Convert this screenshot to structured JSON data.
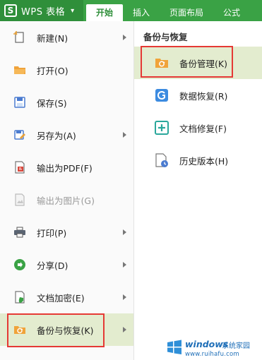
{
  "app": {
    "logo_letter": "S",
    "title": "WPS 表格"
  },
  "tabs": [
    {
      "label": "开始",
      "active": true
    },
    {
      "label": "插入",
      "active": false
    },
    {
      "label": "页面布局",
      "active": false
    },
    {
      "label": "公式",
      "active": false
    }
  ],
  "menu": {
    "items": [
      {
        "label": "新建(N)",
        "icon": "new-file-icon",
        "submenu": true
      },
      {
        "label": "打开(O)",
        "icon": "open-folder-icon",
        "submenu": false
      },
      {
        "label": "保存(S)",
        "icon": "save-icon",
        "submenu": false
      },
      {
        "label": "另存为(A)",
        "icon": "save-as-icon",
        "submenu": true
      },
      {
        "label": "输出为PDF(F)",
        "icon": "pdf-icon",
        "submenu": false
      },
      {
        "label": "输出为图片(G)",
        "icon": "image-export-icon",
        "submenu": false,
        "disabled": true
      },
      {
        "label": "打印(P)",
        "icon": "print-icon",
        "submenu": true
      },
      {
        "label": "分享(D)",
        "icon": "share-icon",
        "submenu": true
      },
      {
        "label": "文档加密(E)",
        "icon": "encrypt-icon",
        "submenu": true
      },
      {
        "label": "备份与恢复(K)",
        "icon": "backup-icon",
        "submenu": true,
        "selected": true
      }
    ]
  },
  "submenu": {
    "header": "备份与恢复",
    "items": [
      {
        "label": "备份管理(K)",
        "icon": "backup-manage-icon",
        "selected": true
      },
      {
        "label": "数据恢复(R)",
        "icon": "data-recovery-icon"
      },
      {
        "label": "文档修复(F)",
        "icon": "doc-repair-icon"
      },
      {
        "label": "历史版本(H)",
        "icon": "history-version-icon"
      }
    ]
  },
  "watermark": {
    "brand": "windows",
    "suffix": "系统家园",
    "url": "www.ruihafu.com"
  },
  "colors": {
    "ribbon": "#3aa245",
    "selected_bg": "#e3eccf",
    "highlight_box": "#e53935"
  }
}
